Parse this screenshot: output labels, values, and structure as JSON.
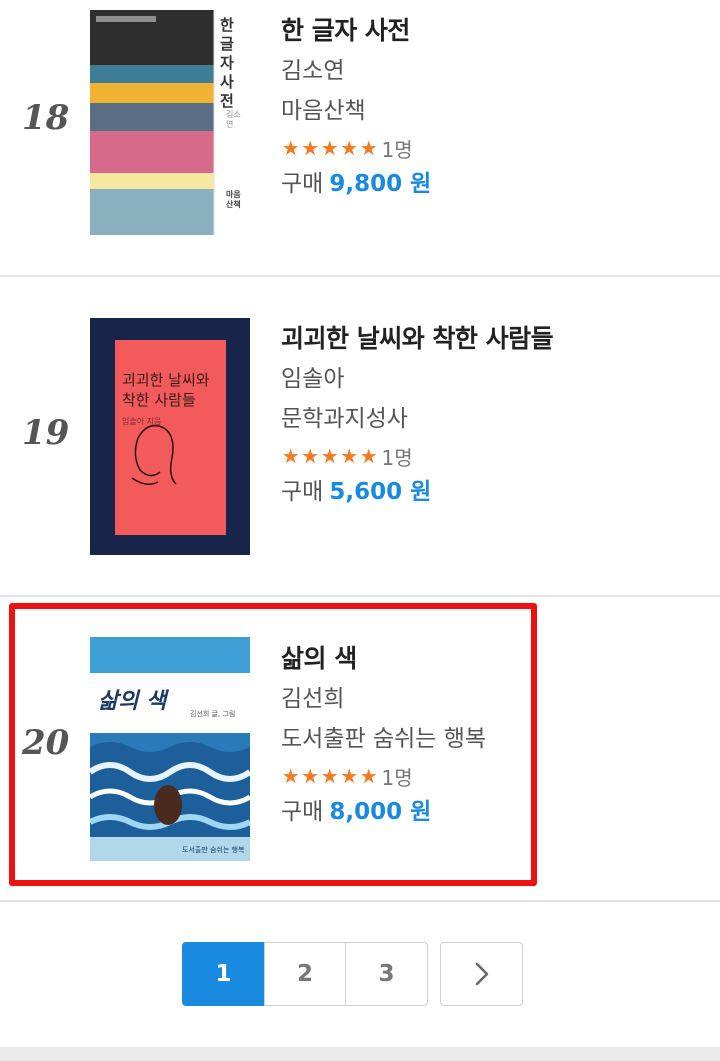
{
  "books": [
    {
      "rank": "18",
      "title": "한 글자 사전",
      "author": "김소연",
      "publisher": "마음산책",
      "rating_count": "1명",
      "price_label": "구매",
      "price": "9,800 원",
      "cover": {
        "title": "한 글자 사전",
        "author": "김소연",
        "publisher": "마음산책",
        "colors": [
          "#2e2e2e",
          "#f2b233",
          "#d66a8a",
          "#f5e8a0",
          "#8ab0bf"
        ]
      }
    },
    {
      "rank": "19",
      "title": "괴괴한 날씨와 착한 사람들",
      "author": "임솔아",
      "publisher": "문학과지성사",
      "rating_count": "1명",
      "price_label": "구매",
      "price": "5,600 원",
      "cover": {
        "title_line1": "괴괴한 날씨와",
        "title_line2": "착한 사람들",
        "author": "임솔아 지음",
        "colors": [
          "#182449",
          "#f35a5c"
        ]
      }
    },
    {
      "rank": "20",
      "title": "삶의 색",
      "author": "김선희",
      "publisher": "도서출판 숨쉬는 행복",
      "rating_count": "1명",
      "price_label": "구매",
      "price": "8,000 원",
      "cover": {
        "title": "삶의 색",
        "author": "김선희 글, 그림",
        "publisher": "도서출판 숨쉬는 행복",
        "colors": [
          "#3d9fd6",
          "#ffffff",
          "#1d5f9a",
          "#4a2a1f"
        ]
      }
    }
  ],
  "stars": 5,
  "pagination": {
    "pages": [
      "1",
      "2",
      "3"
    ],
    "active": "1",
    "next": "chevron-right-icon"
  },
  "accent_color": "#1a8ae0",
  "star_color": "#f27a20",
  "highlight_color": "#ee1111"
}
